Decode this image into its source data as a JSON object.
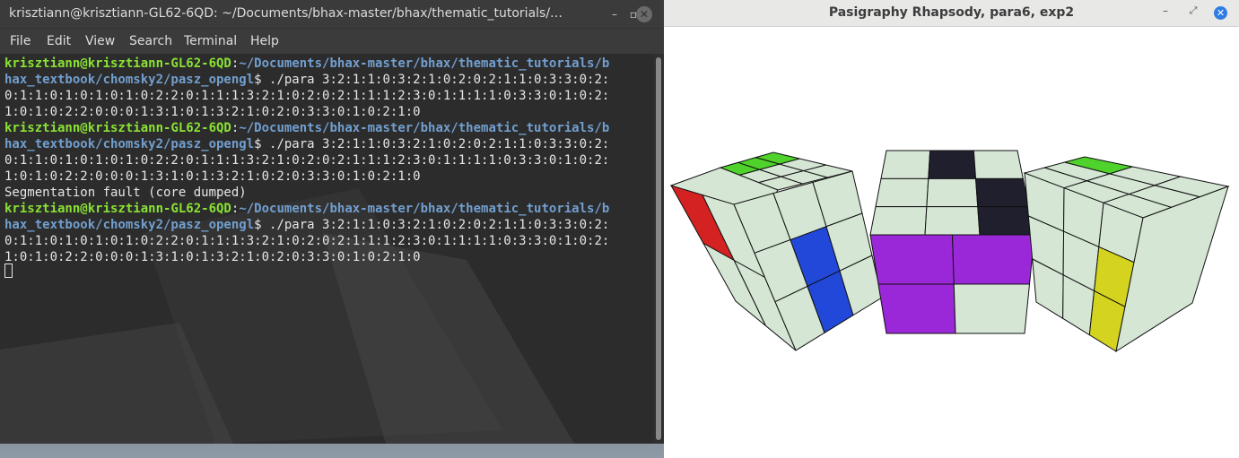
{
  "terminal": {
    "title": "krisztiann@krisztiann-GL62-6QD: ~/Documents/bhax-master/bhax/thematic_tutorials/…",
    "window_buttons": {
      "minimize": "–",
      "maximize": "▫",
      "close": "✕"
    },
    "menu": [
      "File",
      "Edit",
      "View",
      "Search",
      "Terminal",
      "Help"
    ],
    "lines": [
      {
        "user": "krisztiann@krisztiann-GL62-6QD",
        "sep": ":",
        "path": "~/Documents/bhax-master/bhax/thematic_tutorials/b",
        "rest": ""
      },
      {
        "user": "",
        "sep": "",
        "path": "hax_textbook/chomsky2/pasz_opengl",
        "rest": "$ ./para 3:2:1:1:0:3:2:1:0:2:0:2:1:1:0:3:3:0:2:"
      },
      {
        "user": "",
        "sep": "",
        "path": "",
        "rest": "0:1:1:0:1:0:1:0:1:0:2:2:0:1:1:1:3:2:1:0:2:0:2:1:1:1:2:3:0:1:1:1:1:0:3:3:0:1:0:2:"
      },
      {
        "user": "",
        "sep": "",
        "path": "",
        "rest": "1:0:1:0:2:2:0:0:0:1:3:1:0:1:3:2:1:0:2:0:3:3:0:1:0:2:1:0"
      },
      {
        "user": "krisztiann@krisztiann-GL62-6QD",
        "sep": ":",
        "path": "~/Documents/bhax-master/bhax/thematic_tutorials/b",
        "rest": ""
      },
      {
        "user": "",
        "sep": "",
        "path": "hax_textbook/chomsky2/pasz_opengl",
        "rest": "$ ./para 3:2:1:1:0:3:2:1:0:2:0:2:1:1:0:3:3:0:2:"
      },
      {
        "user": "",
        "sep": "",
        "path": "",
        "rest": "0:1:1:0:1:0:1:0:1:0:2:2:0:1:1:1:3:2:1:0:2:0:2:1:1:1:2:3:0:1:1:1:1:0:3:3:0:1:0:2:"
      },
      {
        "user": "",
        "sep": "",
        "path": "",
        "rest": "1:0:1:0:2:2:0:0:0:1:3:1:0:1:3:2:1:0:2:0:3:3:0:1:0:2:1:0"
      },
      {
        "user": "",
        "sep": "",
        "path": "",
        "rest": "Segmentation fault (core dumped)"
      },
      {
        "user": "krisztiann@krisztiann-GL62-6QD",
        "sep": ":",
        "path": "~/Documents/bhax-master/bhax/thematic_tutorials/b",
        "rest": ""
      },
      {
        "user": "",
        "sep": "",
        "path": "hax_textbook/chomsky2/pasz_opengl",
        "rest": "$ ./para 3:2:1:1:0:3:2:1:0:2:0:2:1:1:0:3:3:0:2:"
      },
      {
        "user": "",
        "sep": "",
        "path": "",
        "rest": "0:1:1:0:1:0:1:0:1:0:2:2:0:1:1:1:3:2:1:0:2:0:2:1:1:1:2:3:0:1:1:1:1:0:3:3:0:1:0:2:"
      },
      {
        "user": "",
        "sep": "",
        "path": "",
        "rest": "1:0:1:0:2:2:0:0:0:1:3:1:0:1:3:2:1:0:2:0:3:3:0:1:0:2:1:0"
      }
    ],
    "colors": {
      "background": "#2c2c2c",
      "user": "#8ae234",
      "path": "#729fcf",
      "text": "#e6e6e6"
    }
  },
  "opengl_window": {
    "title": "Pasigraphy Rhapsody, para6, exp2",
    "window_buttons": {
      "minimize": "–",
      "maximize": "⤢",
      "close": "✕"
    },
    "colors": {
      "background": "#ffffff",
      "cell": "#d5e6d5",
      "green": "#4fd22b",
      "red": "#d42222",
      "blue": "#2148d8",
      "dark": "#1f1f2d",
      "purple": "#9a28d8",
      "yellow": "#d3d320",
      "edge": "#111111"
    }
  }
}
